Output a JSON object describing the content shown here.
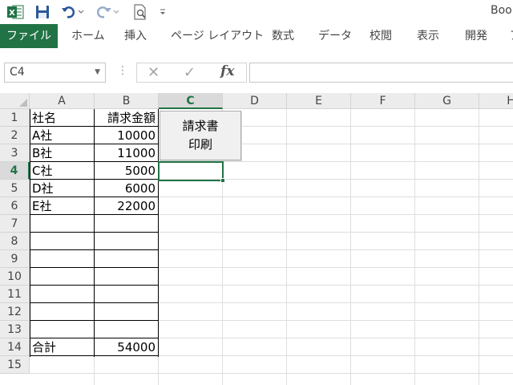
{
  "quick_access": {
    "app_icon": "excel-icon",
    "items": [
      "save-icon",
      "undo-icon",
      "redo-icon",
      "print-preview-icon",
      "customize-qat-icon"
    ]
  },
  "window": {
    "title_partial": "Boo"
  },
  "ribbon": {
    "tabs": [
      "ファイル",
      "ホーム",
      "挿入",
      "ページ レイアウト",
      "数式",
      "データ",
      "校閲",
      "表示",
      "開発",
      "ア"
    ],
    "colors": {
      "file_tab_bg": "#217346",
      "accent": "#217346"
    }
  },
  "formula_bar": {
    "name_box": "C4",
    "dots": "⋮",
    "cancel_glyph": "✕",
    "enter_glyph": "✓",
    "fx_label": "fx",
    "value": ""
  },
  "sheet": {
    "columns": [
      "A",
      "B",
      "C",
      "D",
      "E",
      "F",
      "G",
      "H"
    ],
    "rows": [
      "1",
      "2",
      "3",
      "4",
      "5",
      "6",
      "7",
      "8",
      "9",
      "10",
      "11",
      "12",
      "13",
      "14",
      "15"
    ],
    "active_cell": "C4",
    "cells": [
      {
        "a": "社名",
        "b": "請求金額"
      },
      {
        "a": "A社",
        "b": "10000"
      },
      {
        "a": "B社",
        "b": "11000"
      },
      {
        "a": "C社",
        "b": "5000"
      },
      {
        "a": "D社",
        "b": "6000"
      },
      {
        "a": "E社",
        "b": "22000"
      },
      {
        "a": "",
        "b": ""
      },
      {
        "a": "",
        "b": ""
      },
      {
        "a": "",
        "b": ""
      },
      {
        "a": "",
        "b": ""
      },
      {
        "a": "",
        "b": ""
      },
      {
        "a": "",
        "b": ""
      },
      {
        "a": "",
        "b": ""
      },
      {
        "a": "合計",
        "b": "54000"
      },
      {
        "a": "",
        "b": ""
      }
    ],
    "print_button": {
      "line1": "請求書",
      "line2": "印刷"
    }
  }
}
